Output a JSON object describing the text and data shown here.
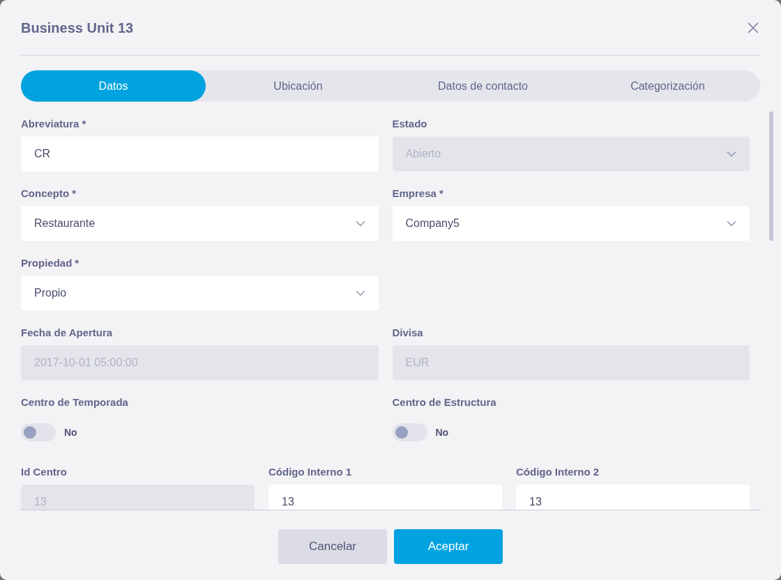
{
  "dialog": {
    "title": "Business Unit 13"
  },
  "tabs": [
    {
      "label": "Datos",
      "selected": true
    },
    {
      "label": "Ubicación",
      "selected": false
    },
    {
      "label": "Datos de contacto",
      "selected": false
    },
    {
      "label": "Categorización",
      "selected": false
    }
  ],
  "form_rows": [
    {
      "fields": [
        {
          "kind": "text",
          "label": "Abreviatura",
          "required_mark": "*",
          "value": "CR",
          "disabled": false
        },
        {
          "kind": "select",
          "label": "Estado",
          "value": "Abierto",
          "disabled": true
        }
      ]
    },
    {
      "fields": [
        {
          "kind": "select",
          "label": "Concepto",
          "required_mark": "*",
          "value": "Restaurante",
          "disabled": false
        },
        {
          "kind": "select",
          "label": "Empresa",
          "required_mark": "*",
          "value": "Company5",
          "disabled": false
        }
      ]
    },
    {
      "fields": [
        {
          "kind": "select",
          "label": "Propiedad",
          "required_mark": "*",
          "value": "Propio",
          "disabled": false
        }
      ]
    },
    {
      "fields": [
        {
          "kind": "text",
          "label": "Fecha de Apertura",
          "value": "2017-10-01 05:00:00",
          "disabled": true
        },
        {
          "kind": "text",
          "label": "Divisa",
          "value": "EUR",
          "disabled": true
        }
      ]
    },
    {
      "fields": [
        {
          "kind": "toggle",
          "label": "Centro de Temporada",
          "on": false,
          "value": "No"
        },
        {
          "kind": "toggle",
          "label": "Centro de Estructura",
          "on": false,
          "value": "No"
        }
      ]
    },
    {
      "fields": [
        {
          "kind": "text",
          "label": "Id Centro",
          "value": "13",
          "disabled": true
        },
        {
          "kind": "text",
          "label": "Código Interno 1",
          "value": "13",
          "disabled": false
        },
        {
          "kind": "text",
          "label": "Código Interno 2",
          "value": "13",
          "disabled": false
        }
      ]
    }
  ],
  "buttons": [
    {
      "label": "Cancelar",
      "kind": "secondary"
    },
    {
      "label": "Aceptar",
      "kind": "primary"
    }
  ]
}
